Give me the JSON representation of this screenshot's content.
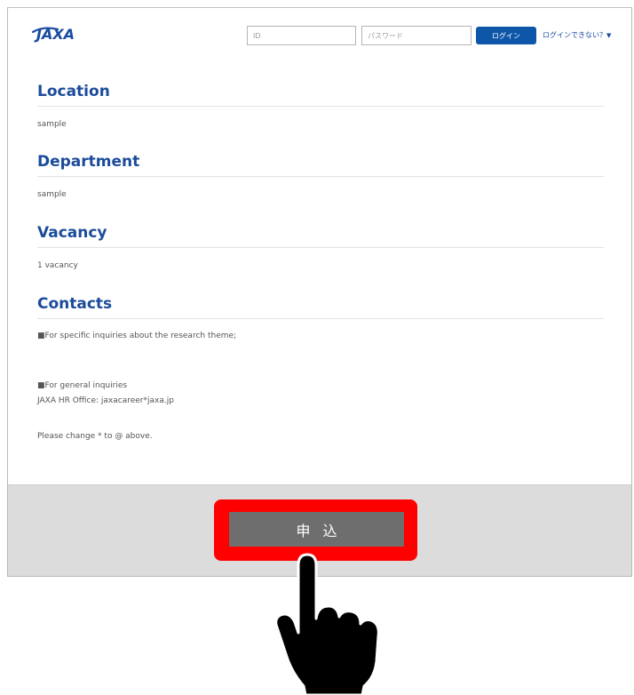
{
  "header": {
    "logo_text": "JAXA",
    "id_placeholder": "ID",
    "password_placeholder": "パスワード",
    "login_label": "ログイン",
    "forgot_label": "ログインできない？",
    "forgot_caret": "▼"
  },
  "sections": {
    "location": {
      "title": "Location",
      "value": "sample"
    },
    "department": {
      "title": "Department",
      "value": "sample"
    },
    "vacancy": {
      "title": "Vacancy",
      "value": "1 vacancy"
    },
    "contacts": {
      "title": "Contacts",
      "specific": "■For specific inquiries about the research theme;",
      "general": "■For general inquiries",
      "office": "JAXA HR Office: jaxacareer*jaxa.jp",
      "note": "Please change * to @ above."
    }
  },
  "footer": {
    "apply_label": "申込"
  },
  "colors": {
    "brand_blue": "#1b4b9b",
    "login_button": "#0e56a8",
    "highlight": "#ff0000",
    "apply_button": "#6e6e6e",
    "footer_bg": "#dcdcdc"
  },
  "icons": {
    "pointer": "pointing-hand-icon"
  }
}
